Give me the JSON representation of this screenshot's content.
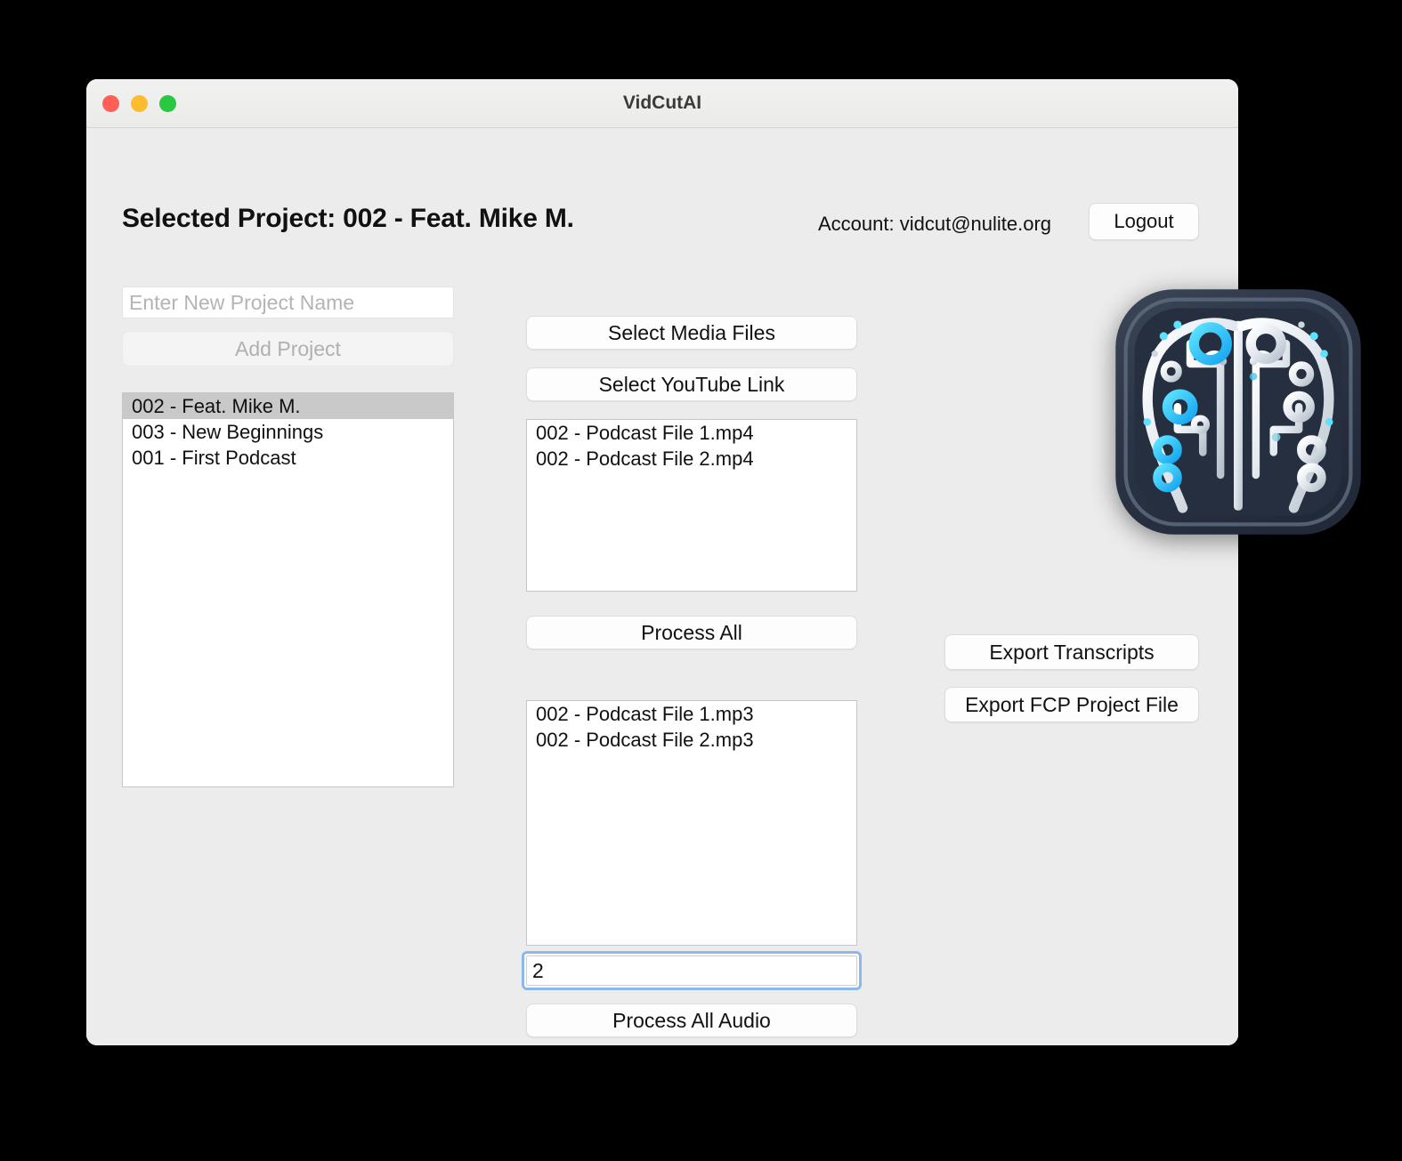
{
  "window": {
    "title": "VidCutAI",
    "traffic_lights": [
      {
        "name": "close",
        "color": "#ff5f57"
      },
      {
        "name": "minimize",
        "color": "#febc2e"
      },
      {
        "name": "maximize",
        "color": "#28c840"
      }
    ]
  },
  "header": {
    "page_title": "Selected Project: 002 - Feat. Mike M.",
    "account_label": "Account: vidcut@nulite.org",
    "logout_label": "Logout"
  },
  "left_panel": {
    "new_project_placeholder": "Enter New Project Name",
    "new_project_value": "",
    "add_project_label": "Add Project",
    "projects": [
      {
        "label": "002 - Feat. Mike M.",
        "selected": true
      },
      {
        "label": "003 - New Beginnings",
        "selected": false
      },
      {
        "label": "001 - First Podcast",
        "selected": false
      }
    ]
  },
  "center_panel": {
    "select_media_label": "Select Media Files",
    "select_youtube_label": "Select YouTube Link",
    "video_files": [
      "002 - Podcast File 1.mp4",
      "002 - Podcast File 2.mp4"
    ],
    "process_all_label": "Process All",
    "audio_files": [
      "002 - Podcast File 1.mp3",
      "002 - Podcast File 2.mp3"
    ],
    "count_value": "2",
    "count_placeholder": "",
    "process_all_audio_label": "Process All Audio"
  },
  "right_panel": {
    "export_transcripts_label": "Export Transcripts",
    "export_fcp_label": "Export FCP Project File",
    "logo_name": "circuit-brain-app-icon"
  },
  "colors": {
    "window_bg": "#ececec",
    "titlebar_bg": "#f1f1f0",
    "list_bg": "#ffffff",
    "selected_row": "#c9c9c9",
    "focus_ring": "#8cb8ea",
    "logo_dark": "#2b3445",
    "logo_cyan": "#2fd4f5",
    "logo_silver": "#e9eef2"
  }
}
